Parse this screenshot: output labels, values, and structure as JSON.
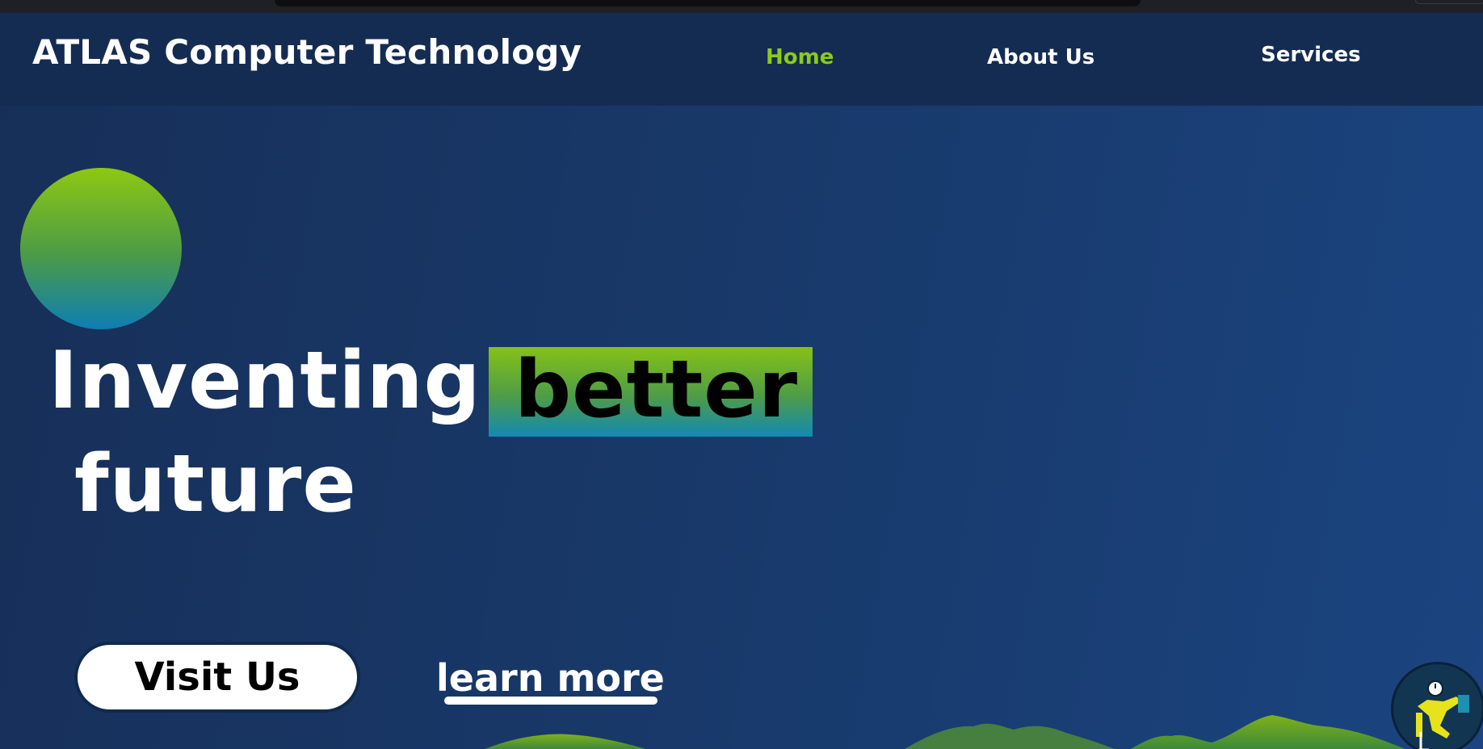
{
  "brand": {
    "name": "ATLAS Computer Technology"
  },
  "nav": {
    "home": "Home",
    "about": "About Us",
    "services": "Services",
    "active": "Home"
  },
  "hero": {
    "headline_start": "Inventing",
    "headline_highlight": "better",
    "headline_end": "future",
    "primary_button": "Visit Us",
    "secondary_link": "learn more"
  },
  "icons": {
    "hero_circle": "gradient-circle",
    "worker": "desk-worker-icon"
  },
  "colors": {
    "accent_green": "#8dca1b",
    "accent_blue": "#128ab5",
    "background": "#17355f",
    "navbar": "#152c52",
    "text": "#ffffff"
  }
}
